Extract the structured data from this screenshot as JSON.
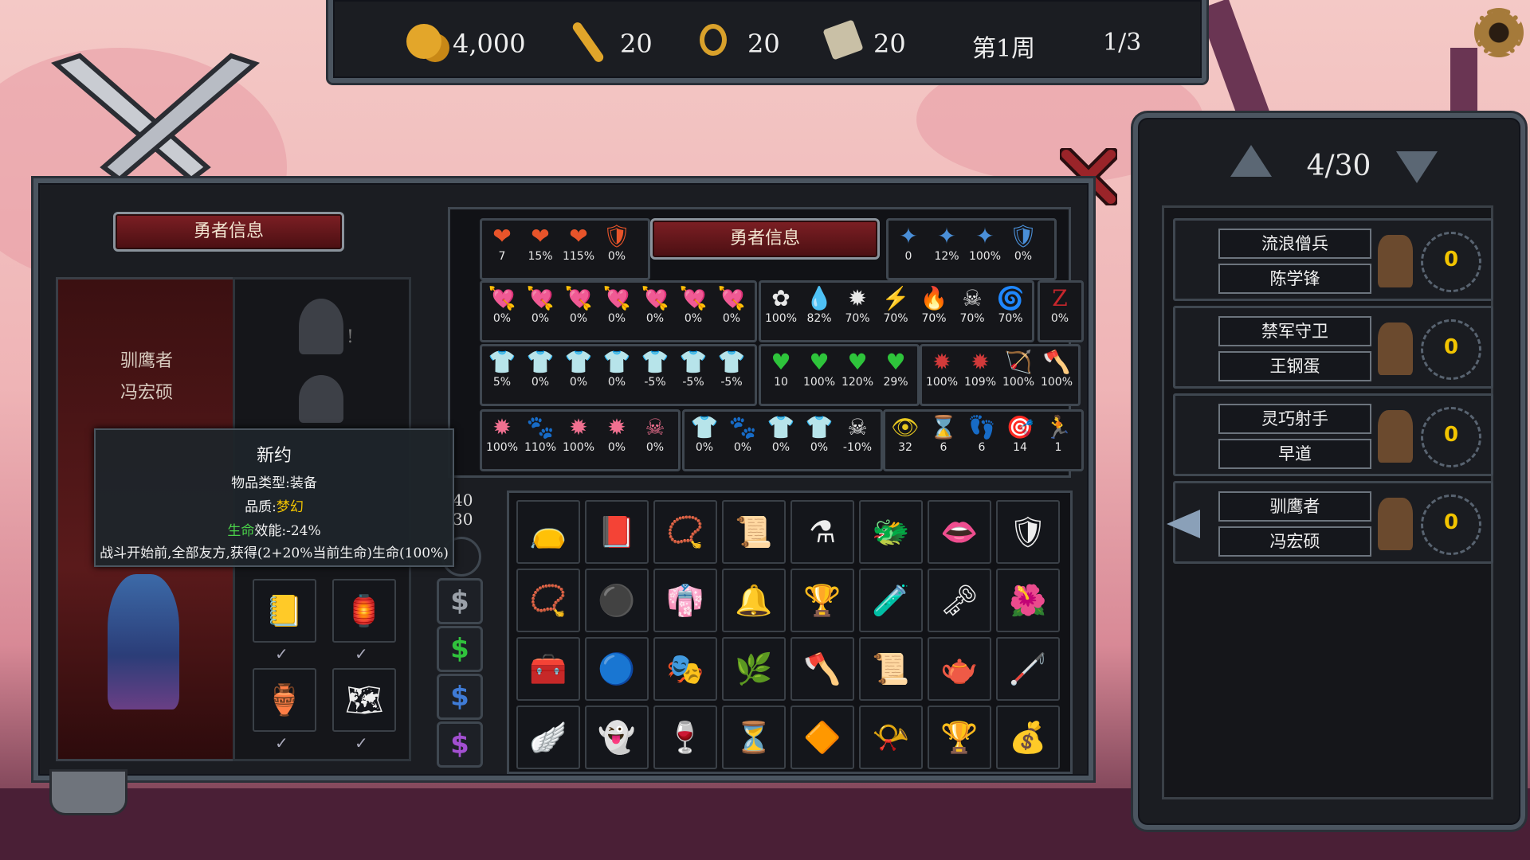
{
  "topbar": {
    "gold": "4,000",
    "wands": "20",
    "rings": "20",
    "scrolls": "20",
    "week": "第1周",
    "progress": "1/3"
  },
  "hero_panel": {
    "header": "勇者信息",
    "hero_class": "驯鹰者",
    "hero_name": "冯宏硕",
    "stat_header": "勇者信息",
    "partial_stat_top": "40",
    "partial_stat_bottom": "30"
  },
  "stats": {
    "row1_left": [
      "7",
      "15%",
      "115%",
      "0%"
    ],
    "row1_right": [
      "0",
      "12%",
      "100%",
      "0%"
    ],
    "row2_a": [
      "0%",
      "0%",
      "0%",
      "0%",
      "0%",
      "0%",
      "0%"
    ],
    "row2_b": [
      "100%",
      "82%",
      "70%",
      "70%",
      "70%",
      "70%",
      "70%"
    ],
    "row2_c": [
      "0%"
    ],
    "row3_a": [
      "5%",
      "0%",
      "0%",
      "0%",
      "-5%",
      "-5%",
      "-5%"
    ],
    "row3_b": [
      "10",
      "100%",
      "120%",
      "29%"
    ],
    "row3_c": [
      "100%",
      "109%",
      "100%",
      "100%"
    ],
    "row4_a": [
      "100%",
      "110%",
      "100%",
      "0%",
      "0%"
    ],
    "row4_b": [
      "0%",
      "0%",
      "0%",
      "0%",
      "-10%"
    ],
    "row4_c": [
      "32",
      "6",
      "6",
      "14",
      "1"
    ]
  },
  "tooltip": {
    "title": "新约",
    "type_line": "物品类型:装备",
    "quality_label": "品质:",
    "quality_value": "梦幻",
    "effect_label": "生命",
    "effect_value": "效能:-24%",
    "description": "战斗开始前,全部友方,获得(2+20%当前生命)生命(100%)"
  },
  "roster": {
    "counter": "4/30",
    "heroes": [
      {
        "class": "流浪僧兵",
        "name": "陈学锋",
        "level": "0"
      },
      {
        "class": "禁军守卫",
        "name": "王钢蛋",
        "level": "0"
      },
      {
        "class": "灵巧射手",
        "name": "早道",
        "level": "0"
      },
      {
        "class": "驯鹰者",
        "name": "冯宏硕",
        "level": "0"
      }
    ]
  },
  "colors": {
    "gold": "#f2c400",
    "quality_dream": "#f2c400",
    "life_green": "#4ad04a",
    "dollar_gray": "#9aa0a8",
    "dollar_green": "#30c23c",
    "dollar_blue": "#3f7bd6",
    "dollar_purple": "#a24fd0"
  },
  "icons": {
    "inventory": [
      "pouch",
      "tome",
      "amulet",
      "letter",
      "potion",
      "dragon-helm",
      "lips",
      "bone-shield",
      "necklace",
      "black-balls",
      "red-robe",
      "bell",
      "chalice",
      "ghost-flask",
      "key",
      "red-flower",
      "chest-box",
      "blue-orb",
      "mask",
      "root",
      "axe",
      "scroll",
      "teapot",
      "staff",
      "wings",
      "ghost-cards",
      "goblet",
      "hourglass",
      "gem-wand",
      "scroll-case",
      "gold-cup",
      "treasure-chest"
    ]
  }
}
